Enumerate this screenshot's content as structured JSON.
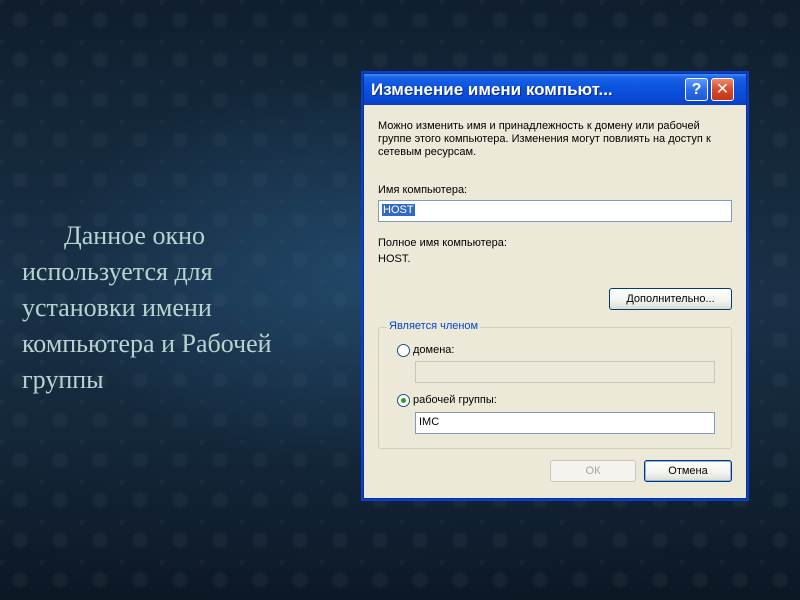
{
  "slide": {
    "text": "Данное окно используется для установки имени компьютера и Рабочей группы"
  },
  "dialog": {
    "title": "Изменение имени компьют...",
    "help_glyph": "?",
    "close_glyph": "✕",
    "description": "Можно изменить имя и принадлежность к домену или рабочей группе этого компьютера. Изменения могут повлиять на доступ к сетевым ресурсам.",
    "computer_name_label": "Имя компьютера:",
    "computer_name_value": "HOST",
    "full_name_label": "Полное имя компьютера:",
    "full_name_value": "HOST.",
    "more_button": "Дополнительно...",
    "member_of": {
      "title": "Является членом",
      "domain_label": "домена:",
      "domain_value": "",
      "domain_selected": false,
      "workgroup_label": "рабочей группы:",
      "workgroup_value": "IMC",
      "workgroup_selected": true
    },
    "ok_button": "ОК",
    "cancel_button": "Отмена"
  },
  "colors": {
    "titlebar": "#0b52df",
    "dialog_bg": "#ece9d8",
    "group_title": "#0046d5",
    "slide_text": "#b9d3d1",
    "close_button": "#d9482a"
  }
}
